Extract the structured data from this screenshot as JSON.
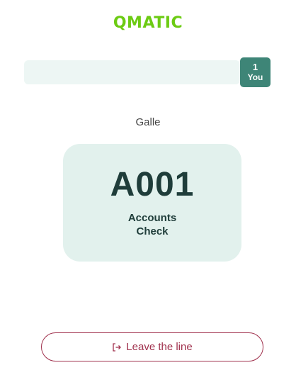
{
  "header": {
    "logo_text": "QMATIC"
  },
  "queue": {
    "position_number": "1",
    "position_label": "You"
  },
  "branch": {
    "name": "Galle"
  },
  "ticket": {
    "number": "A001",
    "service": "Accounts\nCheck"
  },
  "actions": {
    "leave_label": "Leave the line",
    "leave_icon": "exit-icon"
  },
  "colors": {
    "brand_green": "#6ccb13",
    "badge_teal": "#3e8577",
    "card_bg": "#e2f1ed",
    "leave_accent": "#a0314d"
  }
}
